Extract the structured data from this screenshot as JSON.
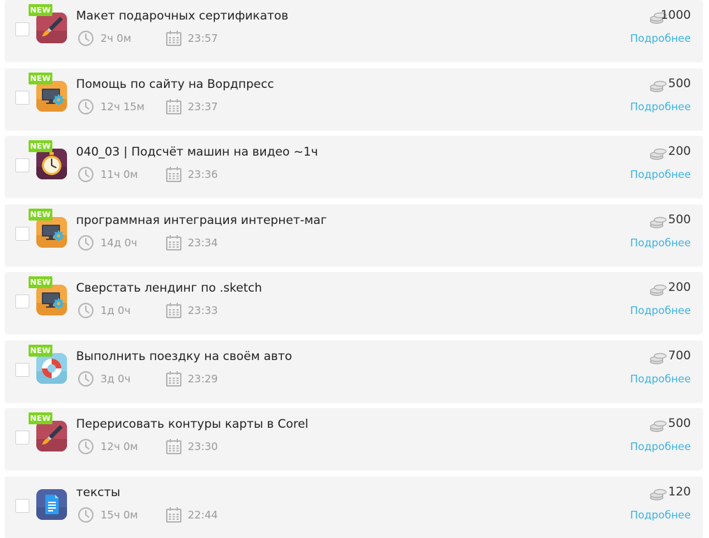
{
  "colors": {
    "badge": "#7ed321",
    "link": "#3ab4e6",
    "row_bg": "#f4f4f4",
    "meta_text": "#9a9a9a"
  },
  "new_badge_label": "NEW",
  "tasks": [
    {
      "is_new": true,
      "category_icon": "design-brush-icon",
      "title": "Макет подарочных сертификатов",
      "duration": "2ч 0м",
      "time": "23:57",
      "price": "1000",
      "details_label": "Подробнее"
    },
    {
      "is_new": true,
      "category_icon": "web-monitor-icon",
      "title": "Помощь по сайту на Вордпресс",
      "duration": "12ч 15м",
      "time": "23:37",
      "price": "500",
      "details_label": "Подробнее"
    },
    {
      "is_new": true,
      "category_icon": "stopwatch-icon",
      "title": "040_03 | Подсчёт машин на видео ~1ч",
      "duration": "11ч 0м",
      "time": "23:36",
      "price": "200",
      "details_label": "Подробнее"
    },
    {
      "is_new": true,
      "category_icon": "web-monitor-icon",
      "title": "программная интеграция интернет-маг",
      "duration": "14д 0ч",
      "time": "23:34",
      "price": "500",
      "details_label": "Подробнее"
    },
    {
      "is_new": true,
      "category_icon": "web-monitor-icon",
      "title": "Сверстать лендинг по .sketch",
      "duration": "1д 0ч",
      "time": "23:33",
      "price": "200",
      "details_label": "Подробнее"
    },
    {
      "is_new": true,
      "category_icon": "lifebuoy-icon",
      "title": "Выполнить поездку на своём авто",
      "duration": "3д 0ч",
      "time": "23:29",
      "price": "700",
      "details_label": "Подробнее"
    },
    {
      "is_new": true,
      "category_icon": "design-brush-icon",
      "title": "Перерисовать контуры карты в Corel",
      "duration": "12ч 0м",
      "time": "23:30",
      "price": "500",
      "details_label": "Подробнее"
    },
    {
      "is_new": false,
      "category_icon": "document-icon",
      "title": "тексты",
      "duration": "15ч 0м",
      "time": "22:44",
      "price": "120",
      "details_label": "Подробнее"
    }
  ]
}
